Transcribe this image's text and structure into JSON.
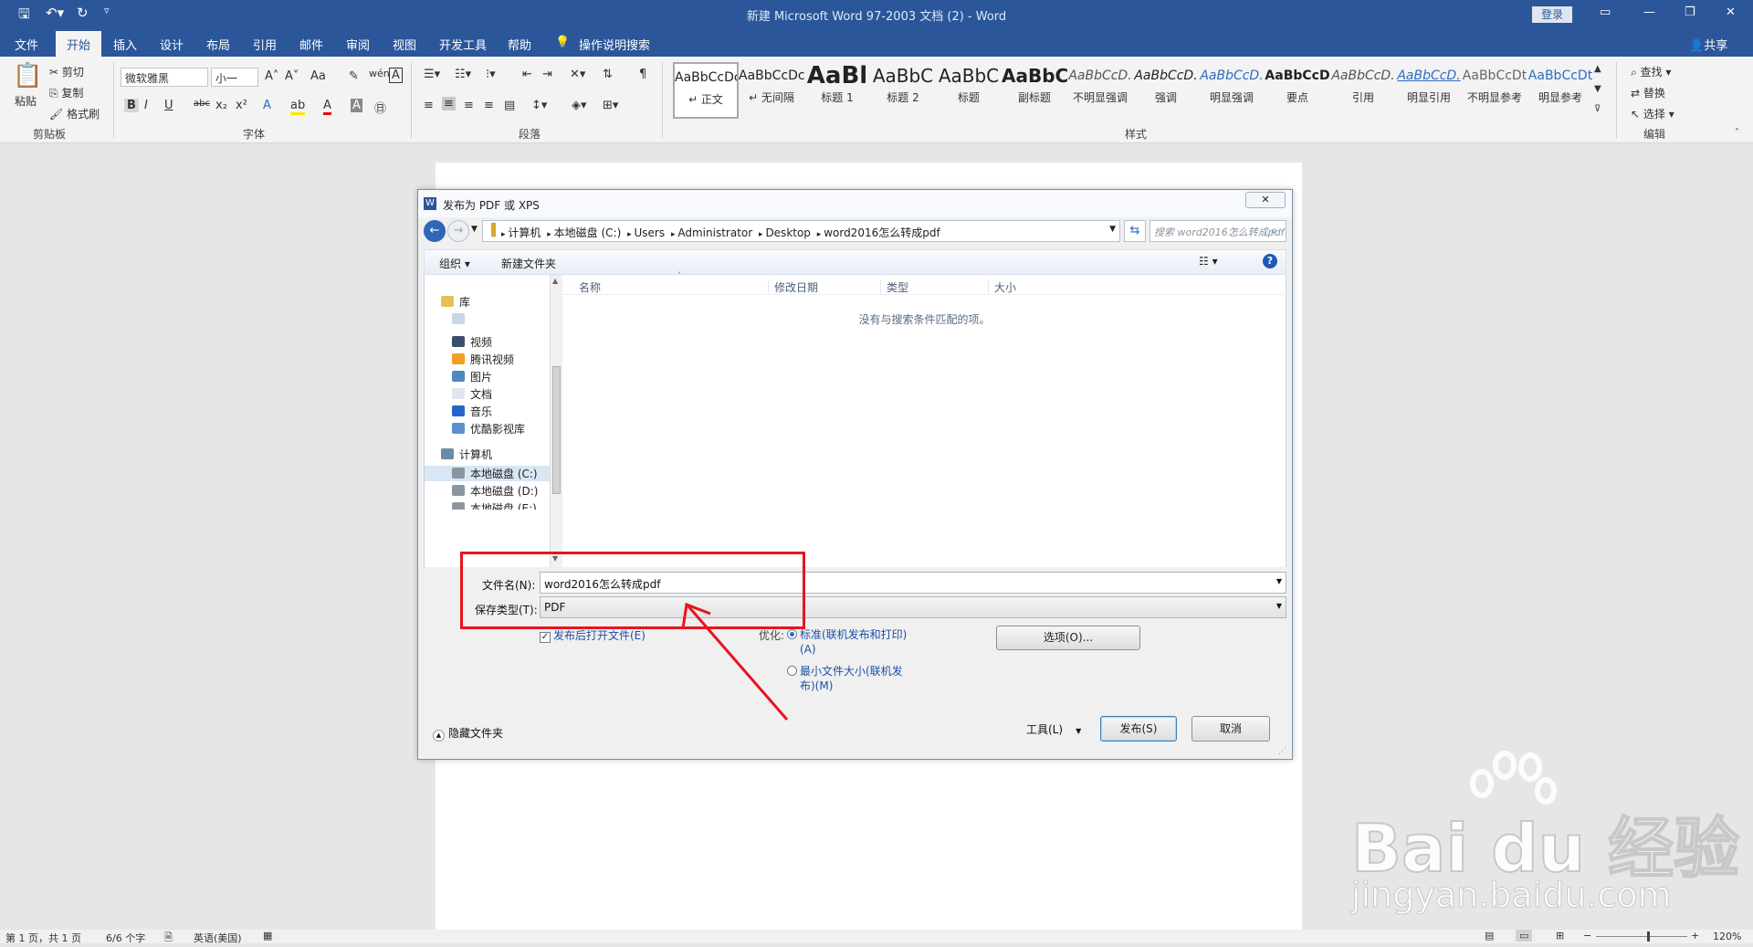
{
  "window": {
    "title": "新建 Microsoft Word 97-2003 文档 (2)  -  Word",
    "login_label": "登录",
    "share_label": "共享"
  },
  "ribbon": {
    "tabs": [
      "文件",
      "开始",
      "插入",
      "设计",
      "布局",
      "引用",
      "邮件",
      "审阅",
      "视图",
      "开发工具",
      "帮助"
    ],
    "active_tab": "开始",
    "tell_me": "操作说明搜索",
    "clipboard": {
      "paste": "粘贴",
      "cut": "剪切",
      "copy": "复制",
      "format_painter": "格式刷",
      "group": "剪贴板"
    },
    "font": {
      "name": "微软雅黑",
      "size": "小一",
      "group": "字体",
      "aa": "Aa"
    },
    "paragraph": {
      "group": "段落"
    },
    "styles": {
      "group": "样式",
      "items": [
        {
          "preview": "AaBbCcDc",
          "name": "↵ 正文"
        },
        {
          "preview": "AaBbCcDc",
          "name": "↵ 无间隔"
        },
        {
          "preview": "AaBl",
          "name": "标题 1"
        },
        {
          "preview": "AaBbC",
          "name": "标题 2"
        },
        {
          "preview": "AaBbC",
          "name": "标题"
        },
        {
          "preview": "AaBbC",
          "name": "副标题"
        },
        {
          "preview": "AaBbCcD.",
          "name": "不明显强调"
        },
        {
          "preview": "AaBbCcD.",
          "name": "强调"
        },
        {
          "preview": "AaBbCcD.",
          "name": "明显强调"
        },
        {
          "preview": "AaBbCcD",
          "name": "要点"
        },
        {
          "preview": "AaBbCcD.",
          "name": "引用"
        },
        {
          "preview": "AaBbCcD.",
          "name": "明显引用"
        },
        {
          "preview": "AaBbCcDt",
          "name": "不明显参考"
        },
        {
          "preview": "AaBbCcDt",
          "name": "明显参考"
        }
      ]
    },
    "editing": {
      "find": "查找",
      "replace": "替换",
      "select": "选择",
      "group": "编辑"
    }
  },
  "dialog": {
    "title": "发布为 PDF 或 XPS",
    "breadcrumb": [
      "计算机",
      "本地磁盘 (C:)",
      "Users",
      "Administrator",
      "Desktop",
      "word2016怎么转成pdf"
    ],
    "search_placeholder": "搜索 word2016怎么转成pdf",
    "organize": "组织",
    "new_folder": "新建文件夹",
    "nav": {
      "library": "库",
      "items": [
        "视频",
        "腾讯视频",
        "图片",
        "文档",
        "音乐",
        "优酷影视库"
      ],
      "computer": "计算机",
      "drives": [
        "本地磁盘 (C:)",
        "本地磁盘 (D:)",
        "本地磁盘 (E:)"
      ]
    },
    "columns": [
      "名称",
      "修改日期",
      "类型",
      "大小"
    ],
    "empty_message": "没有与搜索条件匹配的项。",
    "filename_label": "文件名(N):",
    "filename_value": "word2016怎么转成pdf",
    "savetype_label": "保存类型(T):",
    "savetype_value": "PDF",
    "open_after": "发布后打开文件(E)",
    "optimize_label": "优化:",
    "opt_standard": "标准(联机发布和打印)\n(A)",
    "opt_min": "最小文件大小(联机发\n布)(M)",
    "options_button": "选项(O)...",
    "hide_folders": "隐藏文件夹",
    "tools": "工具(L)",
    "publish_button": "发布(S)",
    "cancel_button": "取消"
  },
  "status": {
    "page": "第 1 页，共 1 页",
    "words": "6/6 个字",
    "lang": "英语(美国)",
    "zoom": "120%"
  },
  "watermark": {
    "brand": "Bai du 经验",
    "url": "jingyan.baidu.com"
  }
}
